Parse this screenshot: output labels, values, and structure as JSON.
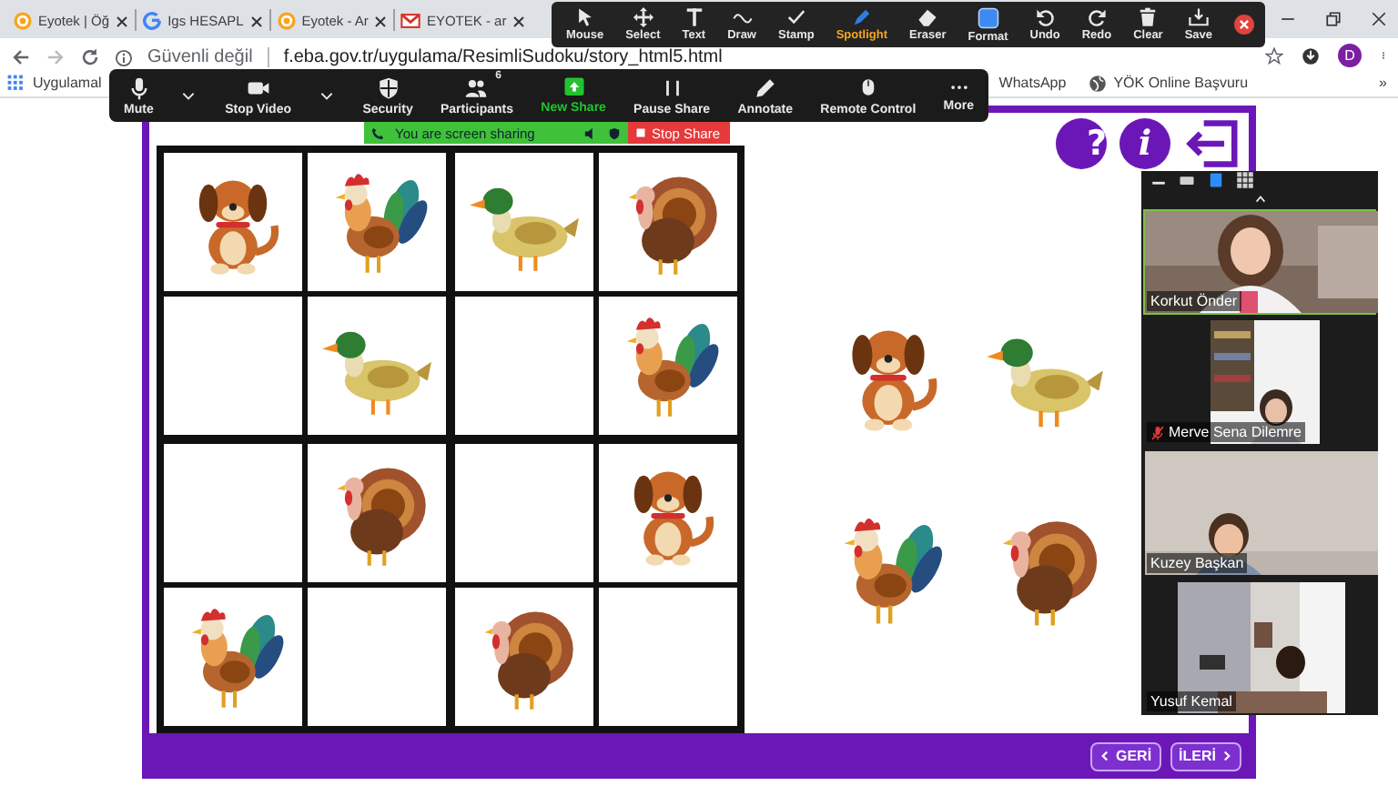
{
  "browser": {
    "tabs": [
      {
        "title": "Eyotek | Öğ",
        "selected": false
      },
      {
        "title": "Igs HESAPL",
        "selected": false
      },
      {
        "title": "Eyotek - Ar",
        "selected": false
      },
      {
        "title": "EYOTEK - ar",
        "selected": false
      }
    ],
    "security_label": "Güvenli değil",
    "url": "f.eba.gov.tr/uygulama/ResimliSudoku/story_html5.html",
    "profile_initial": "D",
    "bookmarks": [
      {
        "label": "Uygulamal"
      },
      {
        "label": "WhatsApp"
      },
      {
        "label": "YÖK Online Başvuru"
      }
    ],
    "bookmarks_more": "»"
  },
  "sudoku": {
    "grid": [
      [
        {
          "kind": "dog"
        },
        {
          "kind": "rooster"
        },
        {
          "kind": "duck"
        },
        {
          "kind": "turkey"
        }
      ],
      [
        {
          "kind": "empty"
        },
        {
          "kind": "duck"
        },
        {
          "kind": "empty"
        },
        {
          "kind": "rooster"
        }
      ],
      [
        {
          "kind": "empty"
        },
        {
          "kind": "turkey"
        },
        {
          "kind": "empty"
        },
        {
          "kind": "dog"
        }
      ],
      [
        {
          "kind": "rooster"
        },
        {
          "kind": "empty"
        },
        {
          "kind": "turkey"
        },
        {
          "kind": "empty"
        }
      ]
    ],
    "options": [
      {
        "kind": "dog"
      },
      {
        "kind": "duck"
      },
      {
        "kind": "rooster"
      },
      {
        "kind": "turkey"
      }
    ],
    "help_buttons": [
      {
        "kind": "help",
        "symbol": "?"
      },
      {
        "kind": "info",
        "symbol": "i"
      },
      {
        "kind": "exit"
      }
    ],
    "nav_buttons": [
      {
        "kind": "back",
        "label": "GERİ"
      },
      {
        "kind": "next",
        "label": "İLERİ"
      }
    ]
  },
  "annotation_toolbar": {
    "tools": [
      {
        "kind": "pointer",
        "label": "Mouse",
        "selected": false
      },
      {
        "kind": "move",
        "label": "Select",
        "selected": false
      },
      {
        "kind": "text",
        "label": "Text",
        "selected": false
      },
      {
        "kind": "wave",
        "label": "Draw",
        "selected": false
      },
      {
        "kind": "check",
        "label": "Stamp",
        "selected": false
      },
      {
        "kind": "pen",
        "label": "Spotlight",
        "selected": true
      },
      {
        "kind": "eraser",
        "label": "Eraser",
        "selected": false
      },
      {
        "kind": "square",
        "label": "Format",
        "selected": false
      },
      {
        "kind": "undo",
        "label": "Undo",
        "selected": false
      },
      {
        "kind": "redo",
        "label": "Redo",
        "selected": false
      },
      {
        "kind": "trash",
        "label": "Clear",
        "selected": false
      },
      {
        "kind": "tray",
        "label": "Save",
        "selected": false
      }
    ]
  },
  "meeting_toolbar": {
    "controls": [
      {
        "kind": "mic",
        "label": "Mute"
      },
      {
        "kind": "caret"
      },
      {
        "kind": "camera",
        "label": "Stop Video"
      },
      {
        "kind": "caret"
      },
      {
        "kind": "shield",
        "label": "Security"
      },
      {
        "kind": "people",
        "label": "Participants",
        "count": "6"
      },
      {
        "kind": "share",
        "label": "New Share"
      },
      {
        "kind": "pause",
        "label": "Pause Share"
      },
      {
        "kind": "pencil",
        "label": "Annotate"
      },
      {
        "kind": "mouse",
        "label": "Remote Control"
      },
      {
        "kind": "dots",
        "label": "More"
      }
    ]
  },
  "share_banner": {
    "message": "You are screen sharing",
    "stop_label": "Stop Share"
  },
  "video_panel": {
    "views": [
      {
        "kind": "thumbnail",
        "selected": false
      },
      {
        "kind": "speaker",
        "selected": true
      },
      {
        "kind": "gallery",
        "selected": false
      }
    ],
    "tiles": [
      {
        "name": "Korkut Önder",
        "active_speaker": true,
        "muted": false
      },
      {
        "name": "Merve Sena Dilemre",
        "active_speaker": false,
        "muted": true
      },
      {
        "name": "Kuzey Başkan",
        "active_speaker": false,
        "muted": false
      },
      {
        "name": "Yusuf Kemal",
        "active_speaker": false,
        "muted": false
      }
    ]
  }
}
